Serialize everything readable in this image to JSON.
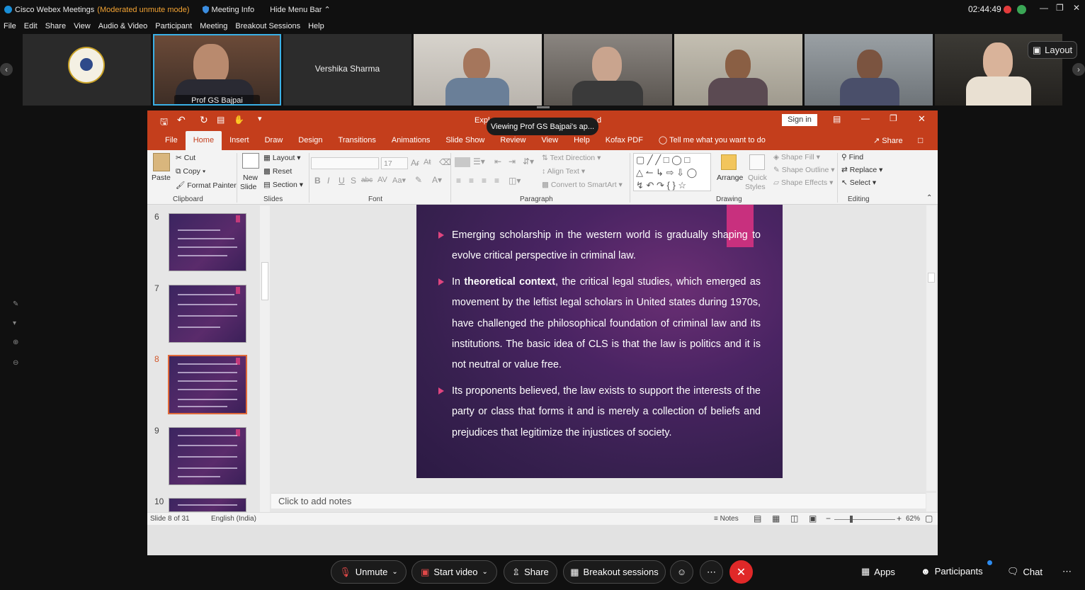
{
  "titlebar": {
    "app": "Cisco Webex Meetings",
    "mode": "(Moderated unmute mode)",
    "meeting_info": "Meeting Info",
    "hide_menu": "Hide Menu Bar",
    "clock": "02:44:49"
  },
  "menubar": [
    "File",
    "Edit",
    "Share",
    "View",
    "Audio & Video",
    "Participant",
    "Meeting",
    "Breakout Sessions",
    "Help"
  ],
  "participants": {
    "host_name": "Prof GS Bajpai",
    "no_video_name": "Vershika Sharma",
    "layout_label": "Layout"
  },
  "toast": "Viewing Prof GS Bajpai's ap...",
  "ppt": {
    "title_fragment_left": "Expl",
    "title_fragment_right": "d",
    "sign_in": "Sign in",
    "tabs": [
      "File",
      "Home",
      "Insert",
      "Draw",
      "Design",
      "Transitions",
      "Animations",
      "Slide Show",
      "Review",
      "View",
      "Help",
      "Kofax PDF"
    ],
    "tell_me": "Tell me what you want to do",
    "share": "Share",
    "clipboard": {
      "paste": "Paste",
      "cut": "Cut",
      "copy": "Copy",
      "format_painter": "Format Painter",
      "label": "Clipboard"
    },
    "slides": {
      "new_slide_1": "New",
      "new_slide_2": "Slide",
      "layout": "Layout",
      "reset": "Reset",
      "section": "Section",
      "label": "Slides"
    },
    "font": {
      "size": "17",
      "label": "Font"
    },
    "paragraph": {
      "text_direction": "Text Direction",
      "align_text": "Align Text",
      "convert": "Convert to SmartArt",
      "label": "Paragraph"
    },
    "drawing": {
      "arrange": "Arrange",
      "quick_styles_1": "Quick",
      "quick_styles_2": "Styles",
      "shape_fill": "Shape Fill",
      "shape_outline": "Shape Outline",
      "shape_effects": "Shape Effects",
      "label": "Drawing"
    },
    "editing": {
      "find": "Find",
      "replace": "Replace",
      "select": "Select",
      "label": "Editing"
    },
    "thumb_numbers": [
      "6",
      "7",
      "8",
      "9",
      "10"
    ],
    "slide": {
      "bullet1": "Emerging scholarship in the western world is gradually shaping to evolve critical perspective in criminal law.",
      "bullet2_pre": "In ",
      "bullet2_bold": "theoretical context",
      "bullet2_post": ", the critical legal studies, which emerged as movement by the leftist legal  scholars in United states during 1970s, have challenged the philosophical foundation of criminal law and its institutions. The basic idea of CLS is that the law is politics and it is not neutral or value free.",
      "bullet3": "Its proponents believed, the law exists to support the interests of the party or class that forms it and is merely a collection of beliefs and prejudices that legitimize the injustices of society."
    },
    "notes_placeholder": "Click to add notes",
    "status": {
      "slide": "Slide 8 of 31",
      "language": "English (India)",
      "notes": "Notes",
      "zoom": "62%"
    }
  },
  "bottombar": {
    "unmute": "Unmute",
    "start_video": "Start video",
    "share": "Share",
    "breakout": "Breakout sessions",
    "apps": "Apps",
    "participants": "Participants",
    "chat": "Chat"
  },
  "colors": {
    "ppt_accent": "#c43e1c",
    "end_call": "#e02828",
    "mode_text": "#f3a333"
  }
}
